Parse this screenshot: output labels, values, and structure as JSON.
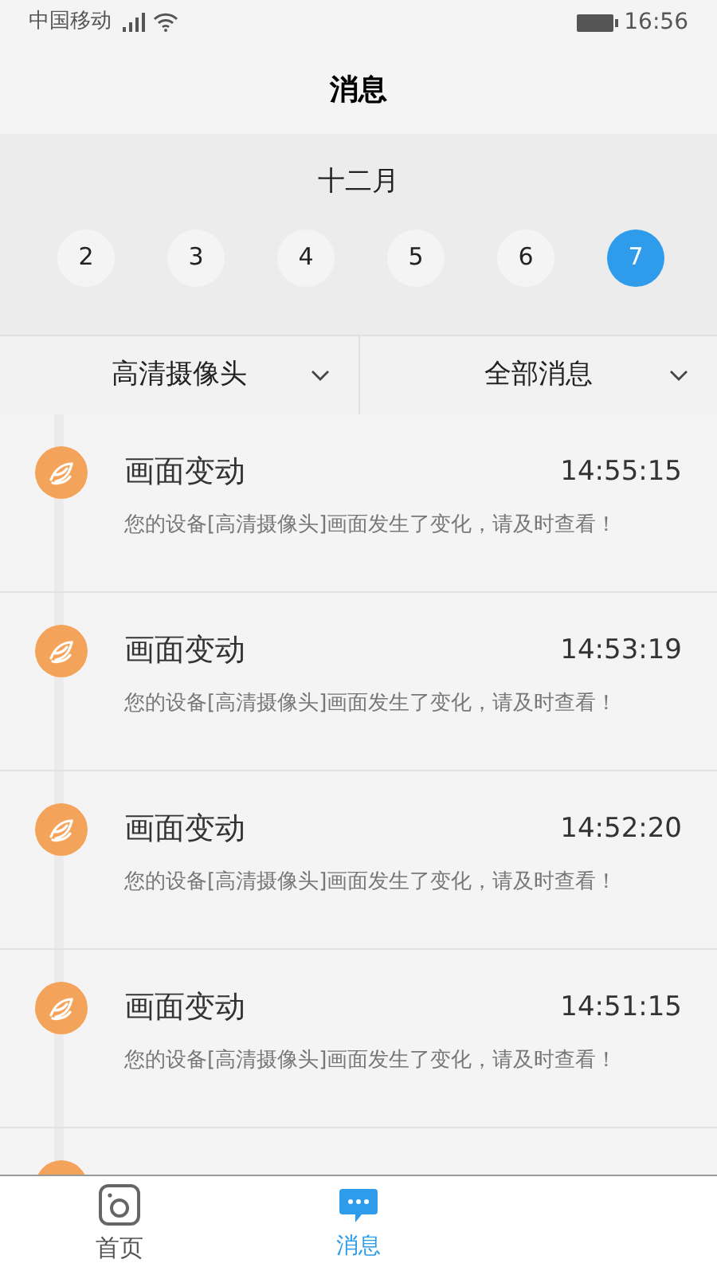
{
  "status_bar": {
    "carrier": "中国移动",
    "time": "16:56"
  },
  "header": {
    "title": "消息"
  },
  "calendar": {
    "month": "十二月",
    "days": [
      {
        "label": "2",
        "selected": false
      },
      {
        "label": "3",
        "selected": false
      },
      {
        "label": "4",
        "selected": false
      },
      {
        "label": "5",
        "selected": false
      },
      {
        "label": "6",
        "selected": false
      },
      {
        "label": "7",
        "selected": true
      }
    ]
  },
  "filters": [
    {
      "label": "高清摄像头"
    },
    {
      "label": "全部消息"
    }
  ],
  "messages": [
    {
      "title": "画面变动",
      "time": "14:55:15",
      "body": "您的设备[高清摄像头]画面发生了变化，请及时查看！"
    },
    {
      "title": "画面变动",
      "time": "14:53:19",
      "body": "您的设备[高清摄像头]画面发生了变化，请及时查看！"
    },
    {
      "title": "画面变动",
      "time": "14:52:20",
      "body": "您的设备[高清摄像头]画面发生了变化，请及时查看！"
    },
    {
      "title": "画面变动",
      "time": "14:51:15",
      "body": "您的设备[高清摄像头]画面发生了变化，请及时查看！"
    }
  ],
  "tab_bar": [
    {
      "label": "首页",
      "kind": "camera",
      "selected": false
    },
    {
      "label": "消息",
      "kind": "chat",
      "selected": true
    }
  ]
}
